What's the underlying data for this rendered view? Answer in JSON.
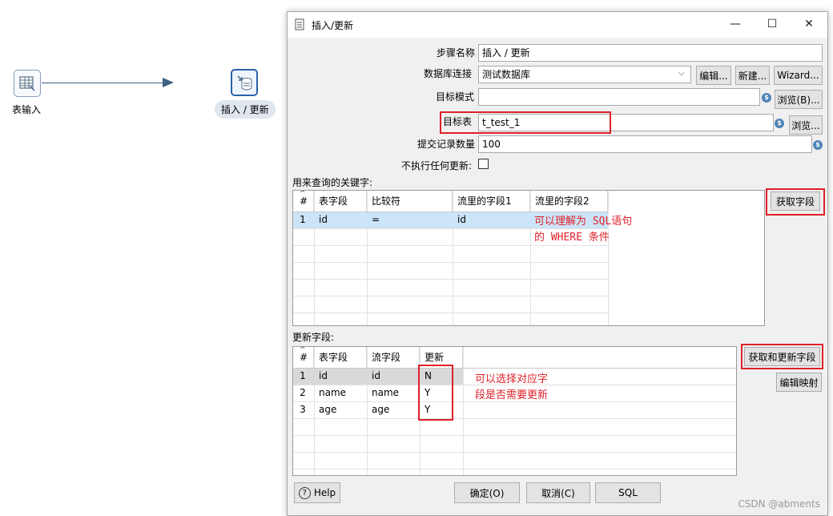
{
  "canvas": {
    "nodes": [
      {
        "label": "表输入",
        "icon": "table-input-icon"
      },
      {
        "label": "插入 / 更新",
        "icon": "insert-update-icon"
      }
    ],
    "hop_color": "#3d5f82"
  },
  "dialog": {
    "title": "插入/更新",
    "window_buttons": {
      "minimize": "—",
      "maximize": "☐",
      "close": "✕"
    },
    "form": {
      "step_name_label": "步骤名称",
      "step_name_value": "插入 / 更新",
      "connection_label": "数据库连接",
      "connection_value": "测试数据库",
      "edit_button": "编辑...",
      "new_button": "新建...",
      "wizard_button": "Wizard...",
      "schema_label": "目标模式",
      "schema_value": "",
      "browse_schema_button": "浏览(B)...",
      "table_label": "目标表",
      "table_value": "t_test_1",
      "browse_table_button": "浏览...",
      "commit_label": "提交记录数量",
      "commit_value": "100",
      "no_update_label": "不执行任何更新:",
      "no_update_checked": false
    },
    "keys_section": {
      "label": "用来查询的关键字:",
      "columns": [
        "#",
        "表字段",
        "比较符",
        "流里的字段1",
        "流里的字段2"
      ],
      "rows": [
        {
          "num": "1",
          "table_field": "id",
          "comparator": "=",
          "stream_field1": "id",
          "stream_field2": ""
        }
      ],
      "get_fields_button": "获取字段",
      "annotation_line1": "可以理解为 SQL语句",
      "annotation_line2": "的 WHERE 条件"
    },
    "update_section": {
      "label": "更新字段:",
      "columns": [
        "#",
        "表字段",
        "流字段",
        "更新"
      ],
      "rows": [
        {
          "num": "1",
          "table_field": "id",
          "stream_field": "id",
          "update": "N"
        },
        {
          "num": "2",
          "table_field": "name",
          "stream_field": "name",
          "update": "Y"
        },
        {
          "num": "3",
          "table_field": "age",
          "stream_field": "age",
          "update": "Y"
        }
      ],
      "get_update_fields_button": "获取和更新字段",
      "edit_mapping_button": "编辑映射",
      "annotation_line1": "可以选择对应字",
      "annotation_line2": "段是否需要更新"
    },
    "footer": {
      "help_button": "Help",
      "ok_button": "确定(O)",
      "cancel_button": "取消(C)",
      "sql_button": "SQL"
    }
  },
  "watermark": "CSDN @abments",
  "colors": {
    "highlight_red": "#e0202a",
    "selected_row": "#cce4f7",
    "row_grey": "#d9d9d9",
    "variable_icon": "#4f84b6"
  }
}
